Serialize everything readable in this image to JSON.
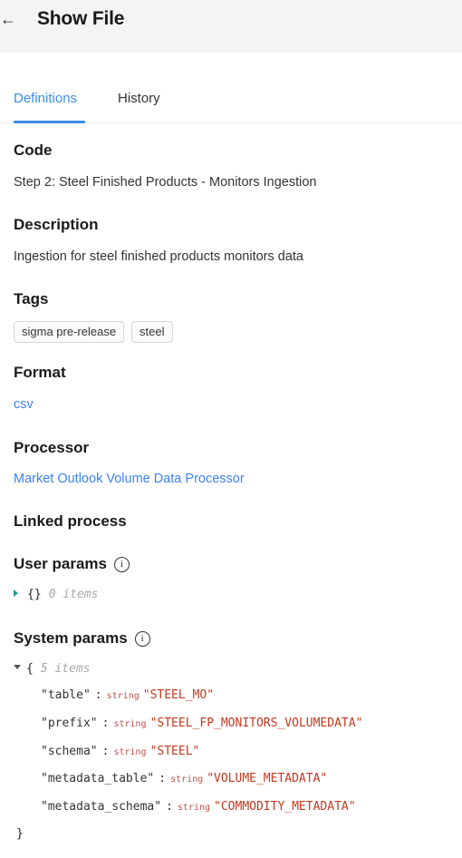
{
  "header": {
    "back_icon": "arrow-left-icon",
    "back_glyph": "←",
    "title": "Show File"
  },
  "tabs": [
    {
      "label": "Definitions",
      "active": true
    },
    {
      "label": "History",
      "active": false
    }
  ],
  "colors": {
    "accent": "#3a8ee6",
    "link": "#3a82f6",
    "header_bg": "#f4f4f4",
    "json_string": "#c2381f",
    "json_type": "#c0524a"
  },
  "sections": {
    "code": {
      "title": "Code",
      "value": "Step 2: Steel Finished Products - Monitors Ingestion"
    },
    "description": {
      "title": "Description",
      "value": "Ingestion for steel finished products monitors data"
    },
    "tags": {
      "title": "Tags",
      "items": [
        "sigma pre-release",
        "steel"
      ]
    },
    "format": {
      "title": "Format",
      "value": "csv"
    },
    "processor": {
      "title": "Processor",
      "value": "Market Outlook Volume Data Processor"
    },
    "linked_process": {
      "title": "Linked process"
    },
    "user_params": {
      "title": "User params",
      "info_icon": "info-icon",
      "collapsed": true,
      "braces": "{}",
      "count_label": "0 items"
    },
    "system_params": {
      "title": "System params",
      "info_icon": "info-icon",
      "collapsed": false,
      "open_brace": "{",
      "close_brace": "}",
      "count_label": "5 items",
      "colon": ":",
      "entries": [
        {
          "key": "\"table\"",
          "type": "string",
          "value": "\"STEEL_MO\""
        },
        {
          "key": "\"prefix\"",
          "type": "string",
          "value": "\"STEEL_FP_MONITORS_VOLUMEDATA\""
        },
        {
          "key": "\"schema\"",
          "type": "string",
          "value": "\"STEEL\""
        },
        {
          "key": "\"metadata_table\"",
          "type": "string",
          "value": "\"VOLUME_METADATA\""
        },
        {
          "key": "\"metadata_schema\"",
          "type": "string",
          "value": "\"COMMODITY_METADATA\""
        }
      ]
    }
  }
}
